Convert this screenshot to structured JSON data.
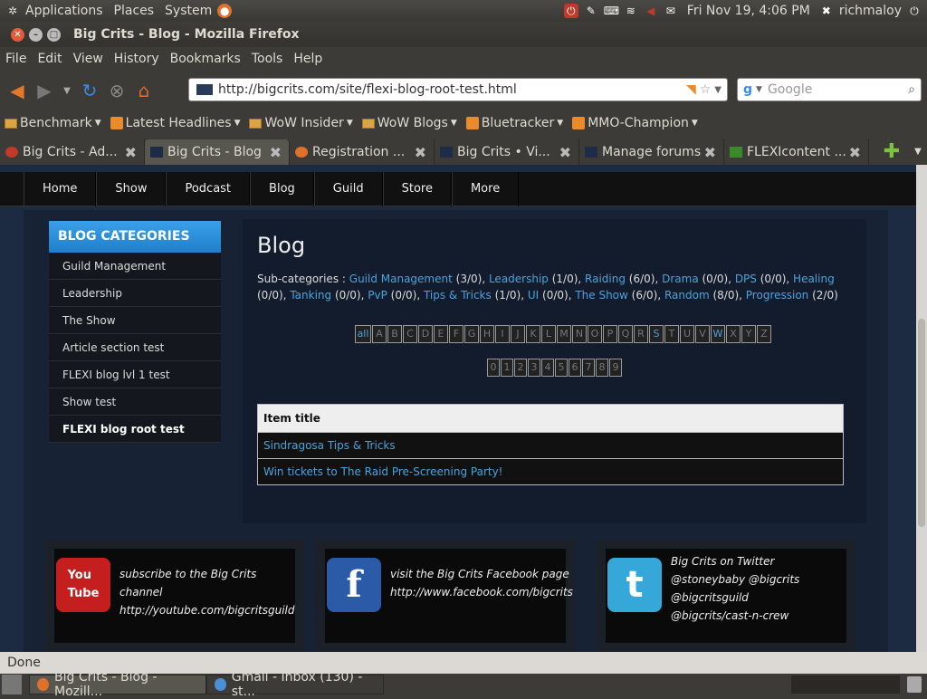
{
  "panel": {
    "menus": [
      "Applications",
      "Places",
      "System"
    ],
    "clock": "Fri Nov 19,  4:06 PM",
    "user": "richmaloy"
  },
  "window": {
    "title": "Big Crits - Blog - Mozilla Firefox"
  },
  "menubar": [
    "File",
    "Edit",
    "View",
    "History",
    "Bookmarks",
    "Tools",
    "Help"
  ],
  "navigation": {
    "url": "http://bigcrits.com/site/flexi-blog-root-test.html",
    "search_placeholder": "Google"
  },
  "bookmarks": [
    {
      "label": "Benchmark",
      "kind": "folder"
    },
    {
      "label": "Latest Headlines",
      "kind": "rss"
    },
    {
      "label": "WoW Insider",
      "kind": "folder"
    },
    {
      "label": "WoW Blogs",
      "kind": "folder"
    },
    {
      "label": "Bluetracker",
      "kind": "rss"
    },
    {
      "label": "MMO-Champion",
      "kind": "rss"
    }
  ],
  "tabs": [
    {
      "label": "Big Crits - Ad...",
      "active": false
    },
    {
      "label": "Big Crits - Blog",
      "active": true
    },
    {
      "label": "Registration ...",
      "active": false
    },
    {
      "label": "Big Crits • Vi...",
      "active": false
    },
    {
      "label": "Manage forums",
      "active": false
    },
    {
      "label": "FLEXIcontent ...",
      "active": false
    }
  ],
  "site_nav": [
    "Home",
    "Show",
    "Podcast",
    "Blog",
    "Guild",
    "Store",
    "More"
  ],
  "sidebar": {
    "heading": "BLOG CATEGORIES",
    "items": [
      "Guild Management",
      "Leadership",
      "The Show",
      "Article section test",
      "FLEXI blog lvl 1 test",
      "Show test",
      "FLEXI blog root test"
    ]
  },
  "main": {
    "title": "Blog",
    "subcat_prefix": "Sub-categories :",
    "subcategories": [
      {
        "name": "Guild Management",
        "count": "(3/0)"
      },
      {
        "name": "Leadership",
        "count": "(1/0)"
      },
      {
        "name": "Raiding",
        "count": "(6/0)"
      },
      {
        "name": "Drama",
        "count": "(0/0)"
      },
      {
        "name": "DPS",
        "count": "(0/0)"
      },
      {
        "name": "Healing",
        "count": "(0/0)"
      },
      {
        "name": "Tanking",
        "count": "(0/0)"
      },
      {
        "name": "PvP",
        "count": "(0/0)"
      },
      {
        "name": "Tips & Tricks",
        "count": "(1/0)"
      },
      {
        "name": "UI",
        "count": "(0/0)"
      },
      {
        "name": "The Show",
        "count": "(6/0)"
      },
      {
        "name": "Random",
        "count": "(8/0)"
      },
      {
        "name": "Progression",
        "count": "(2/0)"
      }
    ],
    "alpha_letters": [
      "all",
      "A",
      "B",
      "C",
      "D",
      "E",
      "F",
      "G",
      "H",
      "I",
      "J",
      "K",
      "L",
      "M",
      "N",
      "O",
      "P",
      "Q",
      "R",
      "S",
      "T",
      "U",
      "V",
      "W",
      "X",
      "Y",
      "Z"
    ],
    "alpha_active": [
      "all",
      "S",
      "W"
    ],
    "alpha_digits": [
      "0",
      "1",
      "2",
      "3",
      "4",
      "5",
      "6",
      "7",
      "8",
      "9"
    ],
    "table_header": "Item title",
    "rows": [
      "Sindragosa Tips & Tricks",
      "Win tickets to The Raid Pre-Screening Party!"
    ]
  },
  "social": [
    {
      "logo": "YouTube",
      "lines": [
        "subscribe to the Big Crits channel",
        "http://youtube.com/bigcritsguild"
      ],
      "color": "#c41e1e"
    },
    {
      "logo": "f",
      "lines": [
        "visit the Big Crits Facebook page",
        "http://www.facebook.com/bigcrits"
      ],
      "color": "#2a5aa8"
    },
    {
      "logo": "t",
      "lines": [
        "Big Crits on Twitter",
        "@stoneybaby @bigcrits @bigcritsguild",
        "@bigcrits/cast-n-crew"
      ],
      "color": "#35a7d8"
    }
  ],
  "statusbar": "Done",
  "taskbar": [
    {
      "label": "Big Crits - Blog - Mozill...",
      "active": true
    },
    {
      "label": "Gmail - Inbox (130) - st...",
      "active": false
    }
  ]
}
